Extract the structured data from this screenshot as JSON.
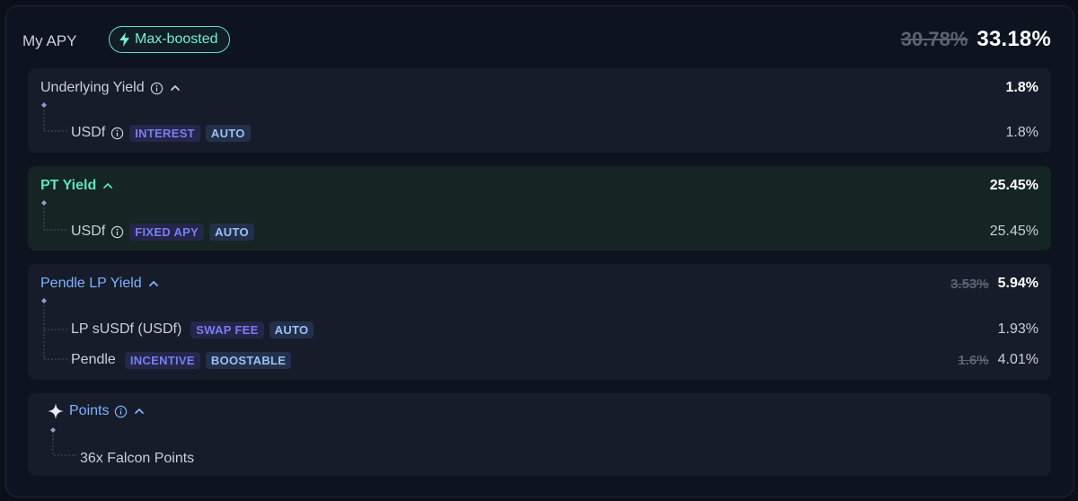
{
  "header": {
    "title": "My APY",
    "badge": "Max-boosted",
    "apy_old": "30.78%",
    "apy_new": "33.18%"
  },
  "underlying": {
    "title": "Underlying Yield",
    "value": "1.8%",
    "items": [
      {
        "name": "USDf",
        "tags": [
          "INTEREST",
          "AUTO"
        ],
        "value": "1.8%"
      }
    ]
  },
  "pt": {
    "title": "PT Yield",
    "value": "25.45%",
    "items": [
      {
        "name": "USDf",
        "tags": [
          "FIXED APY",
          "AUTO"
        ],
        "value": "25.45%"
      }
    ]
  },
  "lp": {
    "title": "Pendle LP Yield",
    "value_old": "3.53%",
    "value": "5.94%",
    "items": [
      {
        "name": "LP sUSDf (USDf)",
        "tags": [
          "SWAP FEE",
          "AUTO"
        ],
        "value": "1.93%"
      },
      {
        "name": "Pendle",
        "tags": [
          "INCENTIVE",
          "BOOSTABLE"
        ],
        "value_old": "1.6%",
        "value": "4.01%"
      }
    ]
  },
  "points": {
    "title": "Points",
    "items": [
      {
        "name": "36x Falcon Points"
      }
    ]
  },
  "colors": {
    "accent_green": "#5fe2bd",
    "accent_blue": "#7fb2ff",
    "tag_purple": "#7c7df0",
    "tag_blue": "#9cc0f5"
  }
}
